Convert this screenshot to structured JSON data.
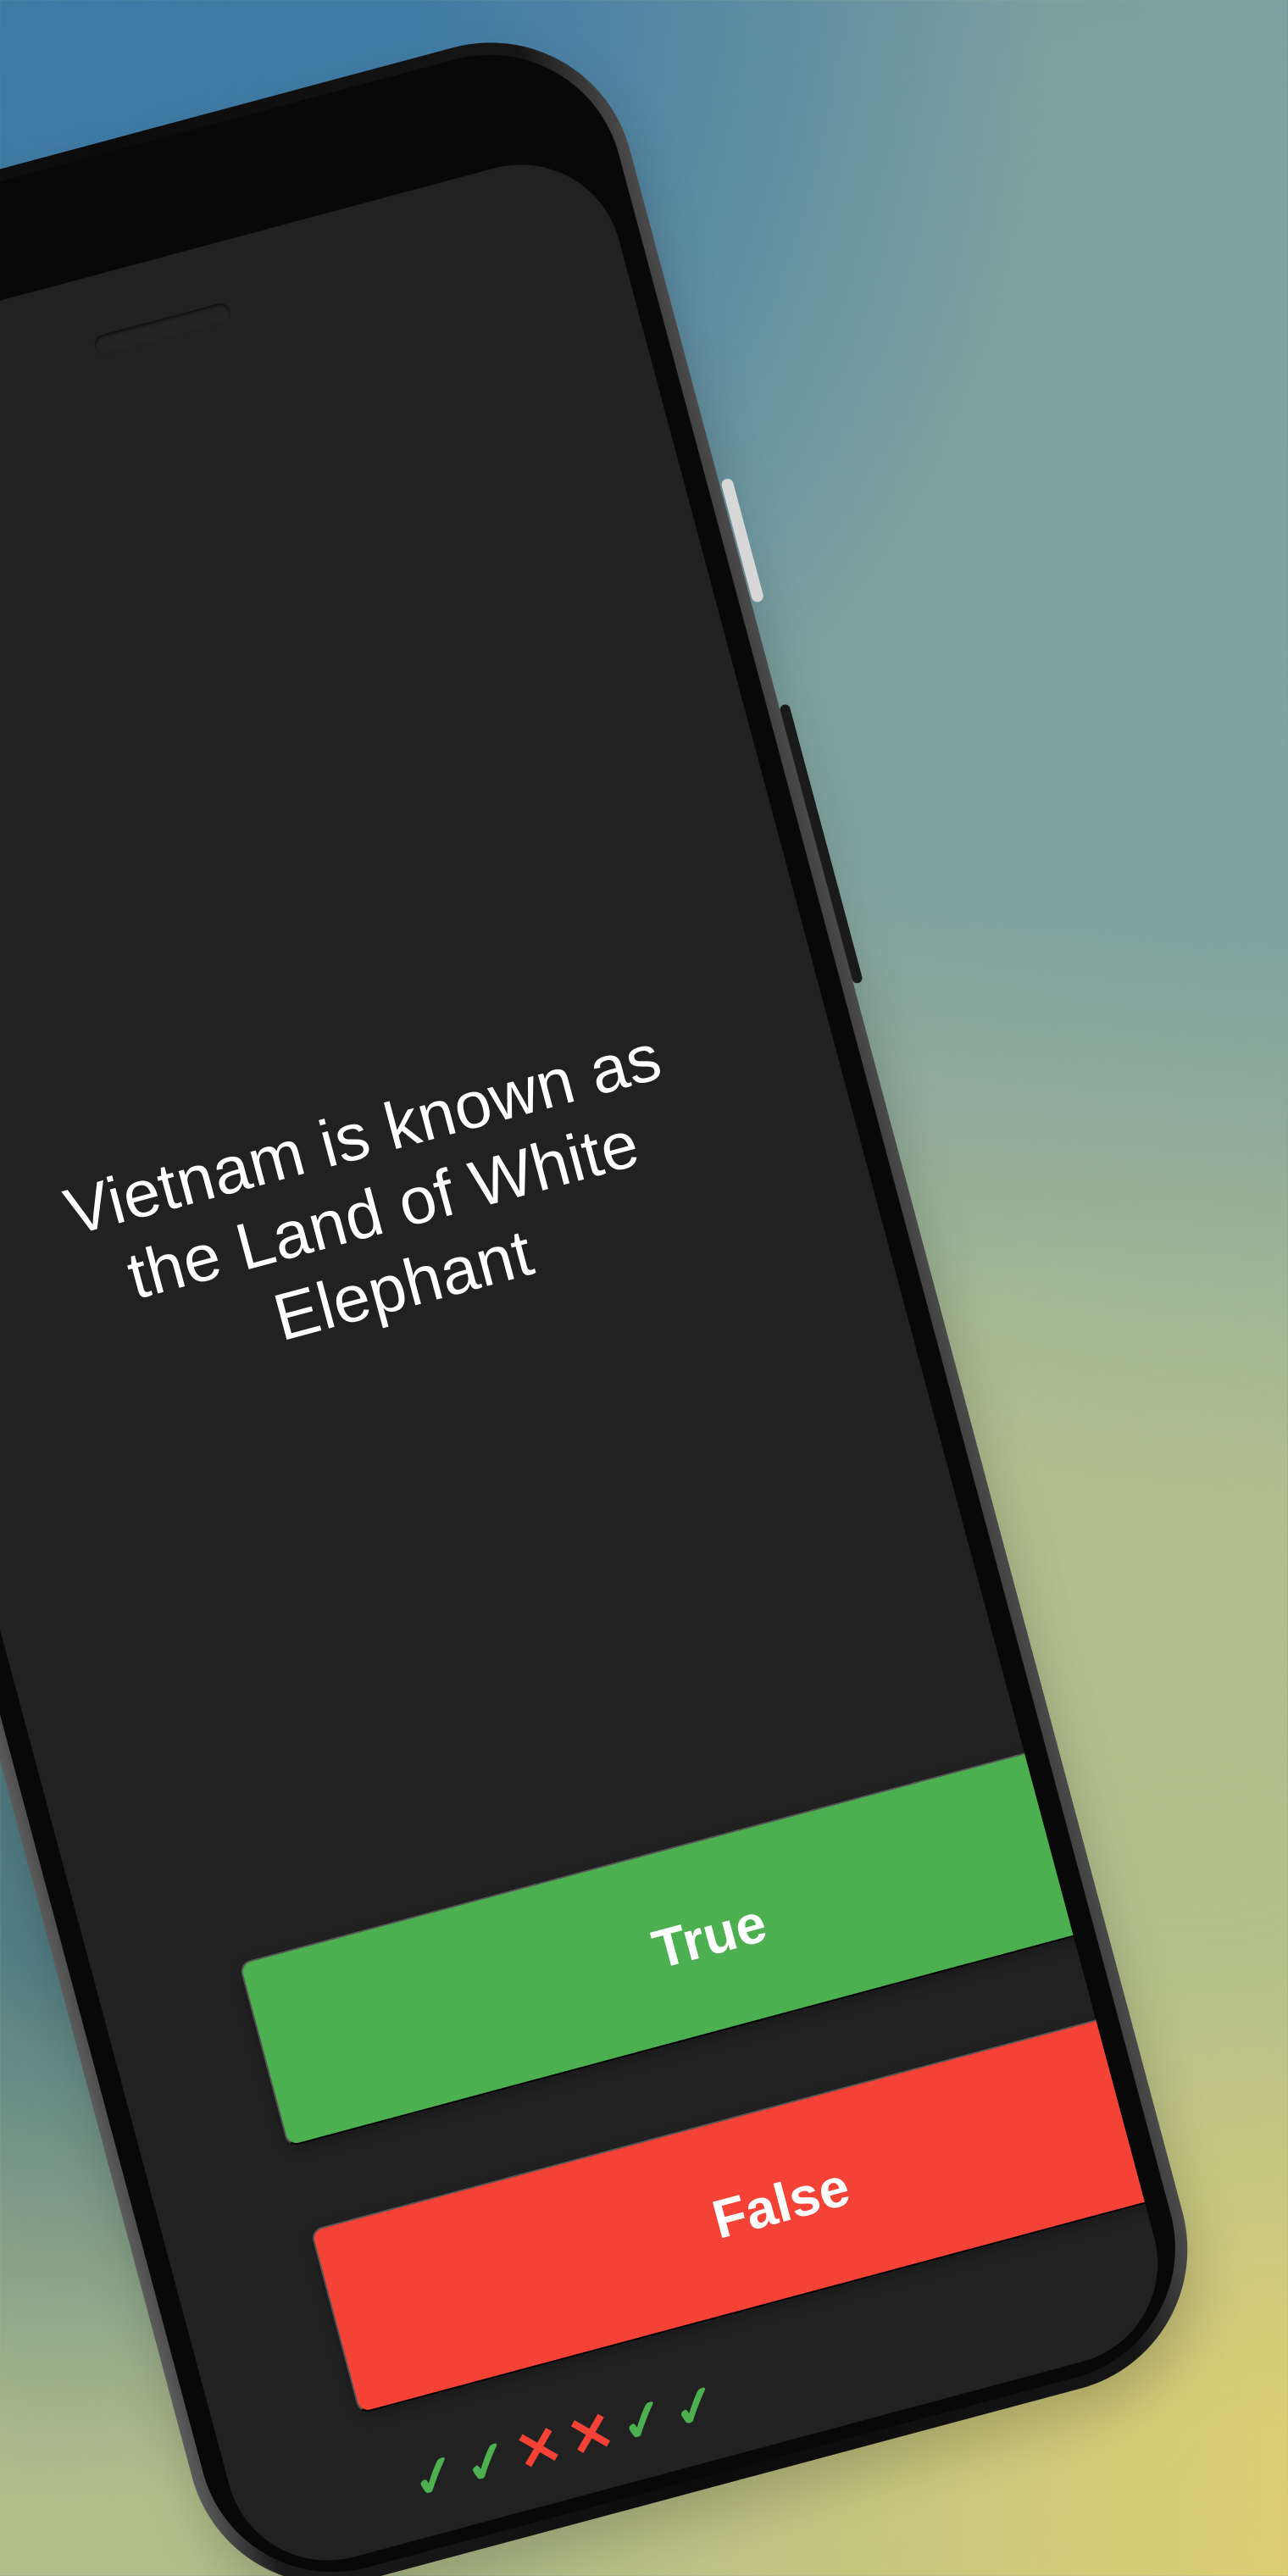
{
  "quiz": {
    "question": "Vietnam is known as the Land of White Elephant",
    "buttons": {
      "true_label": "True",
      "false_label": "False"
    },
    "score_marks": [
      "✓",
      "✓",
      "✕",
      "✕",
      "✓",
      "✓"
    ]
  },
  "colors": {
    "screen_background": "#212121",
    "true_button": "#4caf50",
    "false_button": "#f44336",
    "text": "#ffffff"
  }
}
